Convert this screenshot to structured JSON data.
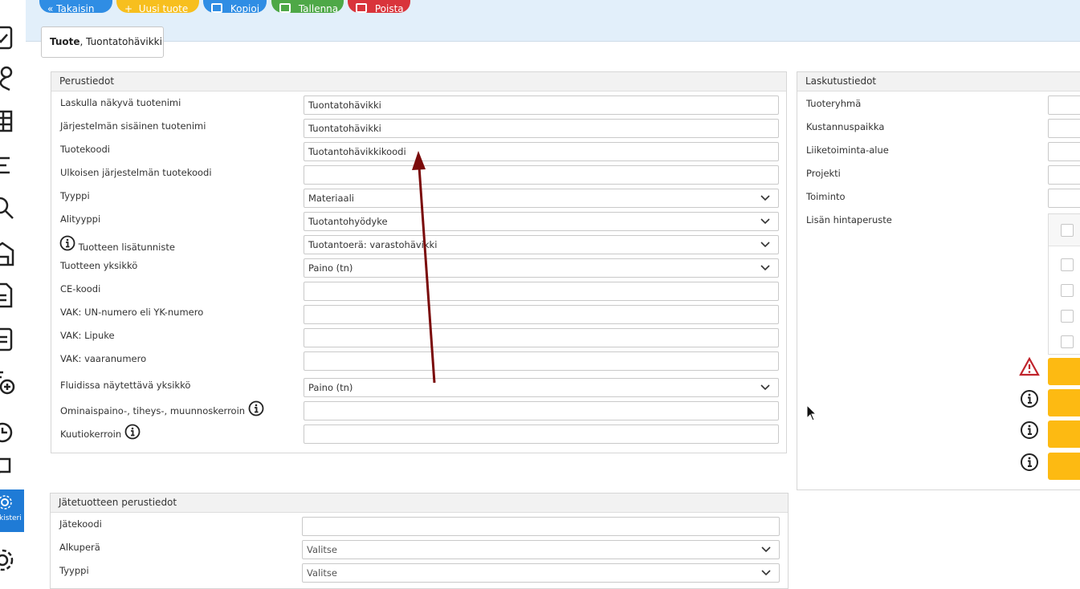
{
  "toolbar": {
    "buttons": [
      {
        "label": "Takaisin",
        "color": "#2f8de4"
      },
      {
        "label": "Uusi tuote",
        "color": "#f7bf1e"
      },
      {
        "label": "Kopioi",
        "color": "#2f8de4"
      },
      {
        "label": "Tallenna",
        "color": "#4ea847"
      },
      {
        "label": "Poista",
        "color": "#d9343b"
      }
    ]
  },
  "tab": {
    "bold": "Tuote",
    "rest": ", Tuontatohävikki"
  },
  "sidebar": {
    "active_label": "rekisteri"
  },
  "basic": {
    "title": "Perustiedot",
    "rows": [
      {
        "label": "Laskulla näkyvä tuotenimi",
        "value": "Tuontatohävikki"
      },
      {
        "label": "Järjestelmän sisäinen tuotenimi",
        "value": "Tuontatohävikki"
      },
      {
        "label": "Tuotekoodi",
        "value": "Tuotantohävikkikoodi"
      },
      {
        "label": "Ulkoisen järjestelmän tuotekoodi",
        "value": ""
      },
      {
        "label": "Tyyppi",
        "value": "Materiaali"
      },
      {
        "label": "Alityyppi",
        "value": "Tuotantohyödyke"
      },
      {
        "label": "Tuotteen lisätunniste",
        "value": "Tuotantoerä: varastohävikki"
      },
      {
        "label": "Tuotteen yksikkö",
        "value": "Paino (tn)"
      },
      {
        "label": "CE-koodi",
        "value": ""
      },
      {
        "label": "VAK: UN-numero eli YK-numero",
        "value": ""
      },
      {
        "label": "VAK: Lipuke",
        "value": ""
      },
      {
        "label": "VAK: vaaranumero",
        "value": ""
      },
      {
        "label": "Fluidissa näytettävä yksikkö",
        "value": "Paino (tn)"
      },
      {
        "label": "Ominaispaino-, tiheys-, muunnoskerroin",
        "value": ""
      },
      {
        "label": "Kuutiokerroin",
        "value": ""
      }
    ]
  },
  "billing": {
    "title": "Laskutustiedot",
    "rows": [
      "Tuoteryhmä",
      "Kustannuspaikka",
      "Liiketoiminta-alue",
      "Projekti",
      "Toiminto",
      "Lisän hintaperuste"
    ]
  },
  "waste": {
    "title": "Jätetuotteen perustiedot",
    "rows": [
      {
        "label": "Jätekoodi",
        "value": ""
      },
      {
        "label": "Alkuperä",
        "value": "Valitse"
      },
      {
        "label": "Tyyppi",
        "value": "Valitse"
      }
    ]
  },
  "colors": {
    "accent": "#1f7bd6",
    "warning": "#fdba12",
    "arrow": "#7a0a0a"
  }
}
